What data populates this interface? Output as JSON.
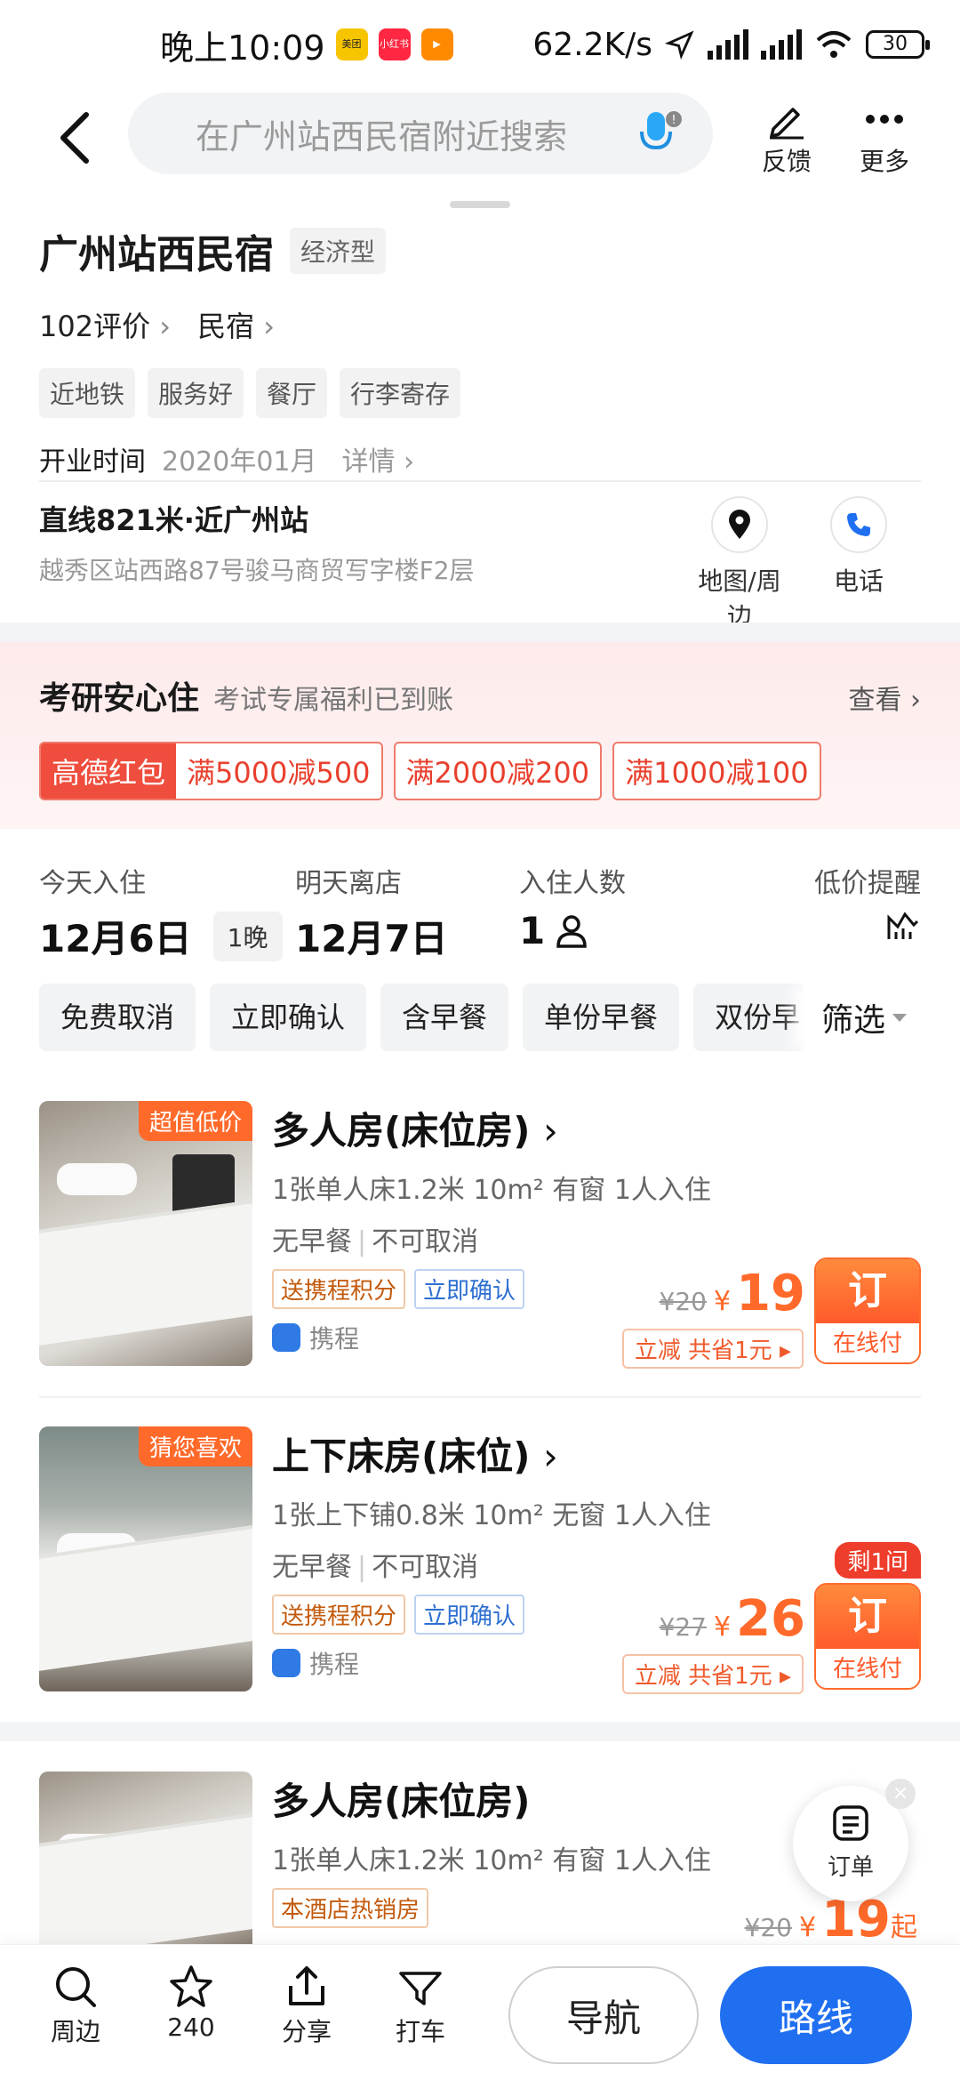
{
  "status": {
    "time": "晚上10:09",
    "apps": [
      {
        "name": "美团",
        "color": "#f7c500"
      },
      {
        "name": "小红书",
        "color": "#ff2741"
      },
      {
        "name": "video-app",
        "color": "#ff8a00"
      }
    ],
    "network_speed": "62.2K/s",
    "battery": "30"
  },
  "nav": {
    "search_placeholder": "在广州站西民宿附近搜索",
    "feedback": "反馈",
    "more": "更多"
  },
  "hotel": {
    "name": "广州站西民宿",
    "type": "经济型",
    "reviews": "102评价",
    "category": "民宿",
    "tags": [
      "近地铁",
      "服务好",
      "餐厅",
      "行李寄存"
    ],
    "open_label": "开业时间",
    "open_value": "2020年01月",
    "details": "详情",
    "distance": "直线821米·近广州站",
    "address": "越秀区站西路87号骏马商贸写字楼F2层",
    "map_label": "地图/周边",
    "phone_label": "电话"
  },
  "promo": {
    "title": "考研安心住",
    "subtitle": "考试专属福利已到账",
    "view": "查看",
    "brand": "高德红包",
    "coupons": [
      "满5000减500",
      "满2000减200",
      "满1000减100"
    ]
  },
  "stay": {
    "checkin_label": "今天入住",
    "checkin_date": "12月6日",
    "nights": "1晚",
    "checkout_label": "明天离店",
    "checkout_date": "12月7日",
    "guests_label": "入住人数",
    "guests": "1",
    "alert_label": "低价提醒"
  },
  "filters": {
    "chips": [
      "免费取消",
      "立即确认",
      "含早餐",
      "单份早餐",
      "双份早"
    ],
    "filter_label": "筛选"
  },
  "rooms": [
    {
      "badge": "超值低价",
      "title": "多人房(床位房)",
      "specs": "1张单人床1.2米  10m²  有窗  1人入住",
      "meal": "无早餐",
      "cancel": "不可取消",
      "tag_points": "送携程积分",
      "tag_confirm": "立即确认",
      "source": "携程",
      "old_price": "¥20",
      "currency": "¥",
      "price": "19",
      "saving": "立减  共省1元 ▸",
      "book": "订",
      "pay": "在线付"
    },
    {
      "badge": "猜您喜欢",
      "title": "上下床房(床位)",
      "specs": "1张上下铺0.8米  10m²  无窗  1人入住",
      "meal": "无早餐",
      "cancel": "不可取消",
      "tag_points": "送携程积分",
      "tag_confirm": "立即确认",
      "source": "携程",
      "left": "剩1间",
      "old_price": "¥27",
      "currency": "¥",
      "price": "26",
      "saving": "立减  共省1元 ▸",
      "book": "订",
      "pay": "在线付"
    },
    {
      "title": "多人房(床位房)",
      "specs": "1张单人床1.2米  10m²  有窗  1人入住",
      "hot": "本酒店热销房",
      "old_price": "¥20",
      "currency": "¥",
      "price": "19",
      "suffix": "起"
    }
  ],
  "float": {
    "order": "订单"
  },
  "bottom": {
    "nearby": "周边",
    "favorites": "240",
    "share": "分享",
    "taxi": "打车",
    "navigate": "导航",
    "route": "路线"
  },
  "colors": {
    "accent_orange": "#ff6a2b",
    "route_blue": "#1f6ff0",
    "coupon_red": "#ef4d3d"
  }
}
